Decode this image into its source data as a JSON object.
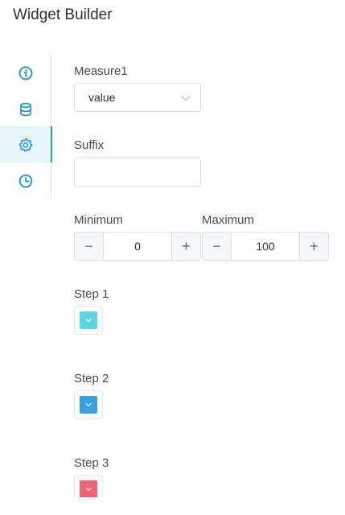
{
  "header": {
    "title": "Widget Builder"
  },
  "sidenav": {
    "items": [
      {
        "icon": "info-icon",
        "active": false
      },
      {
        "icon": "database-icon",
        "active": false
      },
      {
        "icon": "gear-icon",
        "active": true
      },
      {
        "icon": "clock-icon",
        "active": false
      }
    ]
  },
  "form": {
    "measure": {
      "label": "Measure1",
      "value": "value"
    },
    "suffix": {
      "label": "Suffix",
      "value": "",
      "placeholder": ""
    },
    "minimum": {
      "label": "Minimum",
      "value": "0",
      "minus": "−",
      "plus": "+"
    },
    "maximum": {
      "label": "Maximum",
      "value": "100",
      "minus": "−",
      "plus": "+"
    },
    "steps": [
      {
        "label": "Step 1",
        "color": "#5ed6e0"
      },
      {
        "label": "Step 2",
        "color": "#3a9fe0"
      },
      {
        "label": "Step 3",
        "color": "#f06272"
      }
    ]
  },
  "colors": {
    "accent": "#2a9ac8",
    "border": "#dcdfe6"
  }
}
